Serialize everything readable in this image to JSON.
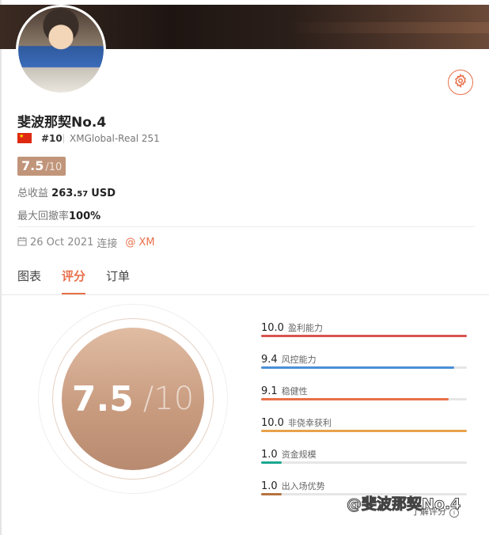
{
  "profile": {
    "name": "斐波那契No.4",
    "rank": "#10",
    "account": "XMGlobal-Real 251",
    "score_value": "7.5",
    "score_max": "/10",
    "profit_label": "总收益",
    "profit_main": "263.",
    "profit_decimal": "57",
    "profit_currency": "USD",
    "drawdown_label": "最大回撤率",
    "drawdown_value": "100%",
    "connected_date": "26 Oct 2021",
    "connected_label": "连接",
    "broker": "@ XM"
  },
  "tabs": [
    {
      "label": "图表",
      "active": false
    },
    {
      "label": "评分",
      "active": true
    },
    {
      "label": "订单",
      "active": false
    }
  ],
  "gauge": {
    "value": "7.5",
    "max": "/10"
  },
  "metrics": [
    {
      "value": "10.0",
      "label": "盈利能力",
      "fraction": 1.0,
      "color": "#d9534f"
    },
    {
      "value": "9.4",
      "label": "风控能力",
      "fraction": 0.94,
      "color": "#4a8fd6"
    },
    {
      "value": "9.1",
      "label": "稳健性",
      "fraction": 0.91,
      "color": "#e8704a"
    },
    {
      "value": "10.0",
      "label": "非侥幸获利",
      "fraction": 1.0,
      "color": "#e8a24a"
    },
    {
      "value": "1.0",
      "label": "资金规模",
      "fraction": 0.1,
      "color": "#1aa78f"
    },
    {
      "value": "1.0",
      "label": "出入场优势",
      "fraction": 0.1,
      "color": "#b5733e"
    }
  ],
  "learn_more": "了解评分",
  "watermark": "@斐波那契No.4",
  "colors": {
    "accent": "#e8704a",
    "badge": "#c0957a"
  },
  "icons": {
    "settings": "gear-icon",
    "calendar": "calendar-icon",
    "info": "info-icon",
    "flag": "china-flag-icon"
  }
}
